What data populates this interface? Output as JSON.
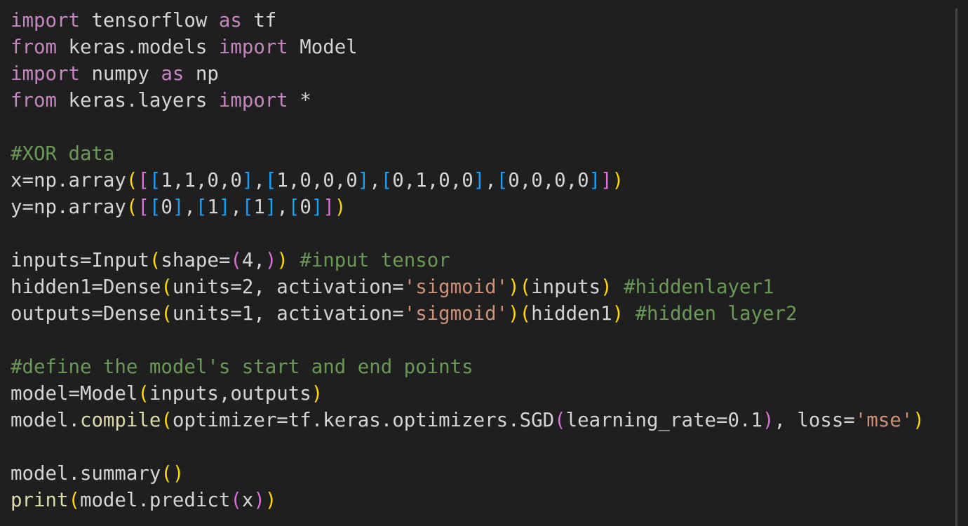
{
  "editor": {
    "language": "python",
    "colors": {
      "background": "#1f1f1f",
      "text": "#d4d4d4",
      "keyword": "#c586c0",
      "function": "#dcdcaa",
      "string": "#ce9178",
      "number": "#b5cea8",
      "comment": "#6a9955",
      "bracket_level_1": "#ffd700",
      "bracket_level_2": "#da70d6",
      "bracket_level_3": "#179fff"
    },
    "lines": [
      [
        [
          "kw",
          "import"
        ],
        [
          "t",
          " tensorflow "
        ],
        [
          "kw",
          "as"
        ],
        [
          "t",
          " tf"
        ]
      ],
      [
        [
          "kw",
          "from"
        ],
        [
          "t",
          " keras.models "
        ],
        [
          "kw",
          "import"
        ],
        [
          "t",
          " Model"
        ]
      ],
      [
        [
          "kw",
          "import"
        ],
        [
          "t",
          " numpy "
        ],
        [
          "kw",
          "as"
        ],
        [
          "t",
          " np"
        ]
      ],
      [
        [
          "kw",
          "from"
        ],
        [
          "t",
          " keras.layers "
        ],
        [
          "kw",
          "import"
        ],
        [
          "t",
          " *"
        ]
      ],
      [],
      [
        [
          "cm",
          "#XOR data"
        ]
      ],
      [
        [
          "t",
          "x=np.array"
        ],
        [
          "b1",
          "("
        ],
        [
          "b2",
          "["
        ],
        [
          "b3",
          "["
        ],
        [
          "t",
          "1,1,0,0"
        ],
        [
          "b3",
          "]"
        ],
        [
          "t",
          ","
        ],
        [
          "b3",
          "["
        ],
        [
          "t",
          "1,0,0,0"
        ],
        [
          "b3",
          "]"
        ],
        [
          "t",
          ","
        ],
        [
          "b3",
          "["
        ],
        [
          "t",
          "0,1,0,0"
        ],
        [
          "b3",
          "]"
        ],
        [
          "t",
          ","
        ],
        [
          "b3",
          "["
        ],
        [
          "t",
          "0,0,0,0"
        ],
        [
          "b3",
          "]"
        ],
        [
          "b2",
          "]"
        ],
        [
          "b1",
          ")"
        ]
      ],
      [
        [
          "t",
          "y=np.array"
        ],
        [
          "b1",
          "("
        ],
        [
          "b2",
          "["
        ],
        [
          "b3",
          "["
        ],
        [
          "t",
          "0"
        ],
        [
          "b3",
          "]"
        ],
        [
          "t",
          ","
        ],
        [
          "b3",
          "["
        ],
        [
          "t",
          "1"
        ],
        [
          "b3",
          "]"
        ],
        [
          "t",
          ","
        ],
        [
          "b3",
          "["
        ],
        [
          "t",
          "1"
        ],
        [
          "b3",
          "]"
        ],
        [
          "t",
          ","
        ],
        [
          "b3",
          "["
        ],
        [
          "t",
          "0"
        ],
        [
          "b3",
          "]"
        ],
        [
          "b2",
          "]"
        ],
        [
          "b1",
          ")"
        ]
      ],
      [],
      [
        [
          "t",
          "inputs=Input"
        ],
        [
          "b1",
          "("
        ],
        [
          "t",
          "shape="
        ],
        [
          "b2",
          "("
        ],
        [
          "t",
          "4,"
        ],
        [
          "b2",
          ")"
        ],
        [
          "b1",
          ")"
        ],
        [
          "t",
          " "
        ],
        [
          "cm",
          "#input tensor"
        ]
      ],
      [
        [
          "t",
          "hidden1=Dense"
        ],
        [
          "b1",
          "("
        ],
        [
          "t",
          "units=2, activation="
        ],
        [
          "str",
          "'sigmoid'"
        ],
        [
          "b1",
          ")"
        ],
        [
          "b1",
          "("
        ],
        [
          "t",
          "inputs"
        ],
        [
          "b1",
          ")"
        ],
        [
          "t",
          " "
        ],
        [
          "cm",
          "#hiddenlayer1"
        ]
      ],
      [
        [
          "t",
          "outputs=Dense"
        ],
        [
          "b1",
          "("
        ],
        [
          "t",
          "units=1, activation="
        ],
        [
          "str",
          "'sigmoid'"
        ],
        [
          "b1",
          ")"
        ],
        [
          "b1",
          "("
        ],
        [
          "t",
          "hidden1"
        ],
        [
          "b1",
          ")"
        ],
        [
          "t",
          " "
        ],
        [
          "cm",
          "#hidden layer2"
        ]
      ],
      [],
      [
        [
          "cm",
          "#define the model's start and end points"
        ]
      ],
      [
        [
          "t",
          "model=Model"
        ],
        [
          "b1",
          "("
        ],
        [
          "t",
          "inputs,outputs"
        ],
        [
          "b1",
          ")"
        ]
      ],
      [
        [
          "t",
          "model."
        ],
        [
          "fn",
          "compile"
        ],
        [
          "b1",
          "("
        ],
        [
          "t",
          "optimizer=tf.keras.optimizers.SGD"
        ],
        [
          "b2",
          "("
        ],
        [
          "t",
          "learning_rate=0.1"
        ],
        [
          "b2",
          ")"
        ],
        [
          "t",
          ", loss="
        ],
        [
          "str",
          "'mse'"
        ],
        [
          "b1",
          ")"
        ]
      ],
      [],
      [
        [
          "t",
          "model.summary"
        ],
        [
          "b1",
          "("
        ],
        [
          "b1",
          ")"
        ]
      ],
      [
        [
          "fn",
          "print"
        ],
        [
          "b1",
          "("
        ],
        [
          "t",
          "model.predict"
        ],
        [
          "b2",
          "("
        ],
        [
          "t",
          "x"
        ],
        [
          "b2",
          ")"
        ],
        [
          "b1",
          ")"
        ]
      ]
    ]
  }
}
